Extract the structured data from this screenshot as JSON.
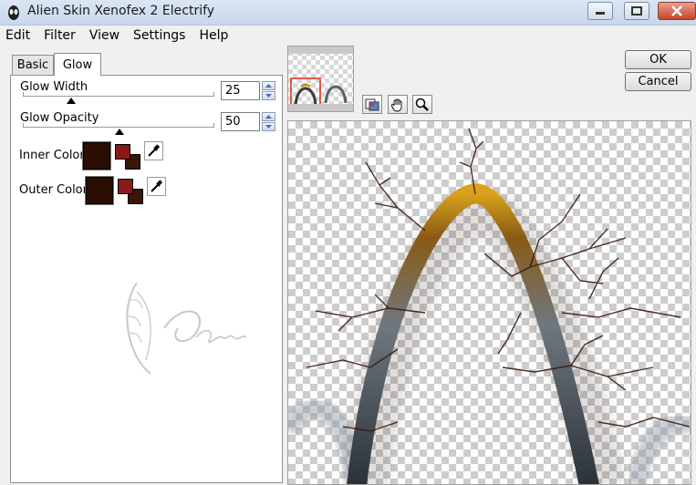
{
  "window": {
    "title": "Alien Skin Xenofex 2 Electrify"
  },
  "menu": [
    "Edit",
    "Filter",
    "View",
    "Settings",
    "Help"
  ],
  "tabs": {
    "basic": "Basic",
    "glow": "Glow",
    "active": "Glow"
  },
  "params": {
    "glow_width": {
      "label": "Glow Width",
      "value": "25"
    },
    "glow_opacity": {
      "label": "Glow Opacity",
      "value": "50"
    }
  },
  "colors": {
    "inner": {
      "label": "Inner Color",
      "swatch": "#2a0d03"
    },
    "outer": {
      "label": "Outer Color",
      "swatch": "#2a0d03"
    },
    "pair_fg": "#8a1a1a",
    "pair_bg": "#3a1508"
  },
  "buttons": {
    "ok": "OK",
    "cancel": "Cancel"
  },
  "tools": [
    "preview-toggle-icon",
    "hand-icon",
    "zoom-icon"
  ]
}
